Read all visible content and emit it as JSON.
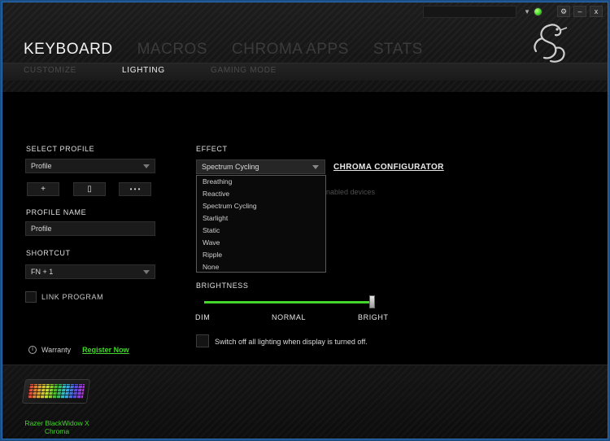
{
  "window": {
    "controls": {
      "settings": "⚙",
      "minimize": "–",
      "close": "x"
    }
  },
  "main_tabs": [
    "KEYBOARD",
    "MACROS",
    "CHROMA APPS",
    "STATS"
  ],
  "sub_tabs": [
    "CUSTOMIZE",
    "LIGHTING",
    "GAMING MODE"
  ],
  "profile": {
    "select_label": "SELECT PROFILE",
    "selected": "Profile",
    "add_button": "+",
    "delete_button": "▯",
    "more_button": "• • •",
    "name_label": "PROFILE NAME",
    "name_value": "Profile",
    "shortcut_label": "SHORTCUT",
    "shortcut_value": "FN + 1",
    "link_program_label": "LINK PROGRAM"
  },
  "warranty": {
    "info_icon": "i",
    "label": "Warranty",
    "register_link": "Register Now"
  },
  "effect": {
    "label": "EFFECT",
    "selected": "Spectrum Cycling",
    "chroma_configurator": "CHROMA CONFIGURATOR",
    "behind_text": "nabled devices",
    "options": [
      "Breathing",
      "Reactive",
      "Spectrum Cycling",
      "Starlight",
      "Static",
      "Wave",
      "Ripple",
      "None"
    ]
  },
  "brightness": {
    "label": "BRIGHTNESS",
    "level": 1.0,
    "dim": "DIM",
    "normal": "NORMAL",
    "bright": "BRIGHT"
  },
  "switch_off": {
    "checked": false,
    "text": "Switch off all lighting when display is turned off."
  },
  "device": {
    "name": "Razer BlackWidow X Chroma"
  },
  "colors": {
    "accent": "#44d62c",
    "background": "#000000",
    "frame": "#2a6fb5"
  }
}
